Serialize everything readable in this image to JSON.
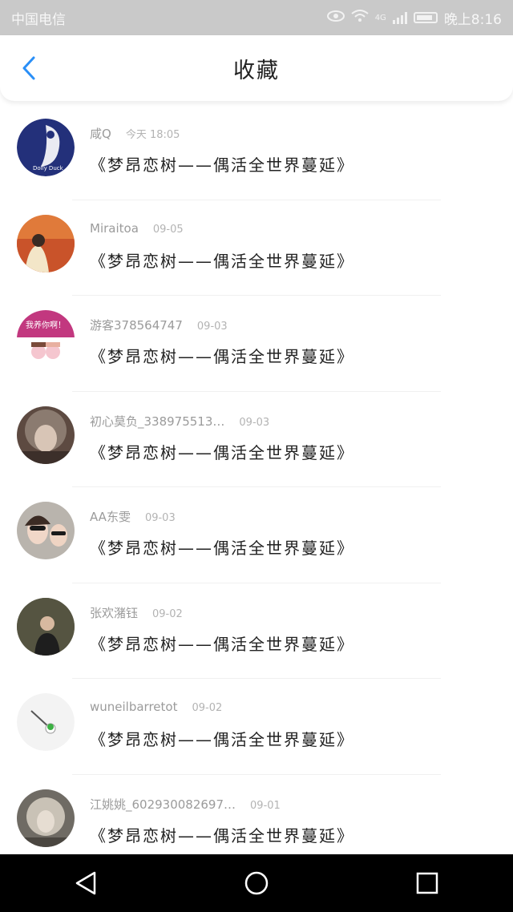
{
  "status_bar": {
    "carrier": "中国电信",
    "network": "4G",
    "time": "晚上8:16"
  },
  "header": {
    "title": "收藏",
    "back_icon": "chevron-left-icon",
    "accent": "#2a8ff7"
  },
  "favorites": [
    {
      "user": "咸Q",
      "time": "今天 18:05",
      "content": "《梦昂恋树——偶活全世界蔓延》",
      "avatar_color": "#23307a",
      "avatar_text": "Dolly Duck"
    },
    {
      "user": "Miraitoa",
      "time": "09-05",
      "content": "《梦昂恋树——偶活全世界蔓延》",
      "avatar_color": "#d9692e",
      "avatar_text": ""
    },
    {
      "user": "游客378564747",
      "time": "09-03",
      "content": "《梦昂恋树——偶活全世界蔓延》",
      "avatar_color": "#c2387f",
      "avatar_text": "我养你啊！"
    },
    {
      "user": "初心莫负_338975513…",
      "time": "09-03",
      "content": "《梦昂恋树——偶活全世界蔓延》",
      "avatar_color": "#6b5246",
      "avatar_text": ""
    },
    {
      "user": "AA东雯",
      "time": "09-03",
      "content": "《梦昂恋树——偶活全世界蔓延》",
      "avatar_color": "#8e8a86",
      "avatar_text": ""
    },
    {
      "user": "张欢潴钰",
      "time": "09-02",
      "content": "《梦昂恋树——偶活全世界蔓延》",
      "avatar_color": "#3b3a2e",
      "avatar_text": ""
    },
    {
      "user": "wuneilbarretot",
      "time": "09-02",
      "content": "《梦昂恋树——偶活全世界蔓延》",
      "avatar_color": "#f2f2f2",
      "avatar_text": ""
    },
    {
      "user": "江姚姚_602930082697…",
      "time": "09-01",
      "content": "《梦昂恋树——偶活全世界蔓延》",
      "avatar_color": "#7d7a73",
      "avatar_text": ""
    }
  ],
  "nav_bar": {
    "back_icon": "triangle-back-icon",
    "home_icon": "circle-home-icon",
    "recents_icon": "square-recents-icon"
  }
}
